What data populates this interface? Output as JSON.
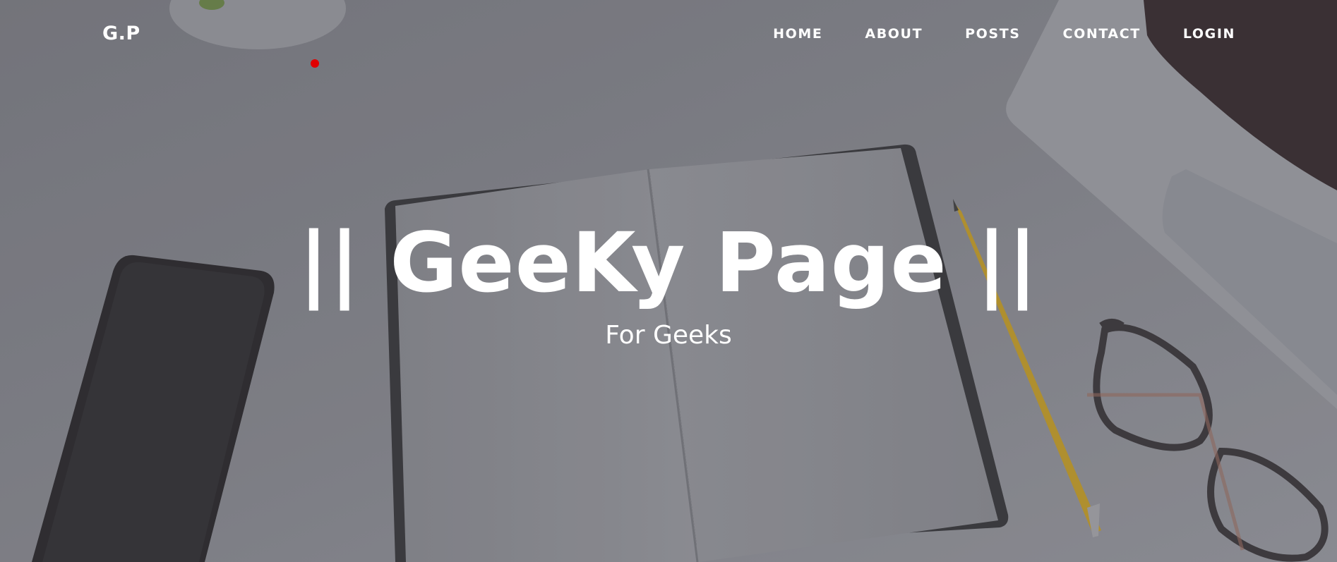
{
  "navbar": {
    "brand": "G.P",
    "links": [
      "HOME",
      "ABOUT",
      "POSTS",
      "CONTACT",
      "LOGIN"
    ]
  },
  "hero": {
    "title": "|| GeeKy Page ||",
    "subtitle": "For Geeks"
  },
  "colors": {
    "text": "#ffffff",
    "indicator_dot": "#e00000",
    "desk_background": "#8a8b90"
  },
  "icons": [
    "red-indicator-dot"
  ]
}
